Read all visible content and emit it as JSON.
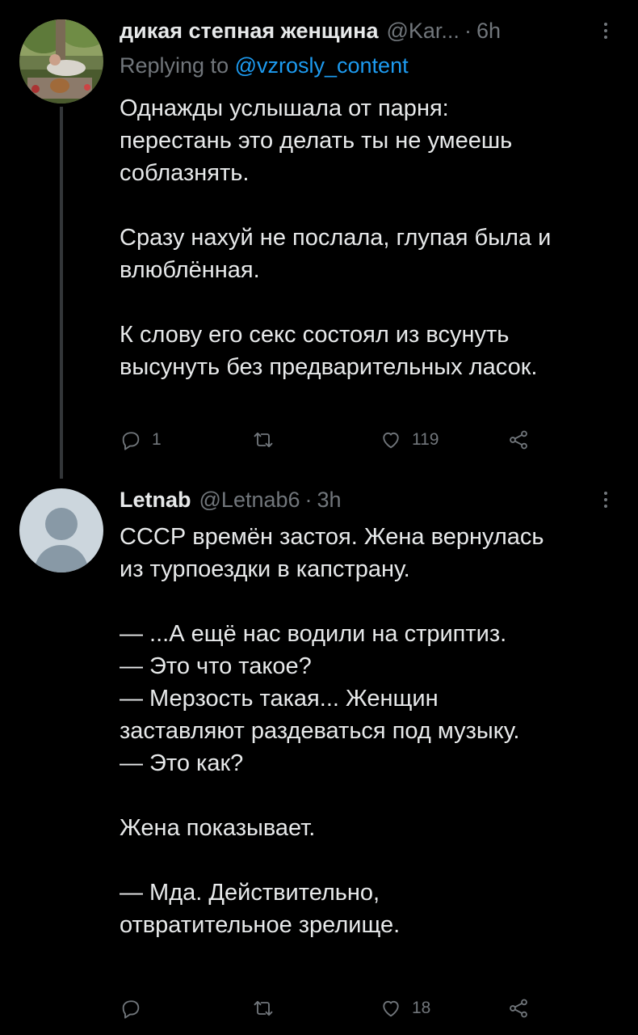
{
  "tweets": [
    {
      "name": "дикая степная женщина",
      "handle": "@Kar...",
      "separator": "·",
      "time": "6h",
      "replying_prefix": "Replying to ",
      "replying_to": "@vzrosly_content",
      "lines": [
        "Однажды услышала от парня:",
        "перестань это делать ты не умеешь",
        "соблазнять.",
        "",
        "Сразу нахуй не послала, глупая была и",
        "влюблённая.",
        "",
        "К слову его секс состоял из всунуть",
        "высунуть без предварительных ласок."
      ],
      "reply_count": "1",
      "retweet_count": "",
      "like_count": "119"
    },
    {
      "name": "Letnab",
      "handle": "@Letnab6",
      "separator": "·",
      "time": "3h",
      "lines": [
        "СССР времён застоя. Жена вернулась",
        "из турпоездки в капстрану.",
        "",
        "— ...А ещё нас водили на стриптиз.",
        "— Это что такое?",
        "— Мерзость такая... Женщин",
        "заставляют раздеваться под музыку.",
        "— Это как?",
        "",
        "Жена показывает.",
        "",
        "— Мда. Действительно,",
        "отвратительное зрелище."
      ],
      "reply_count": "",
      "retweet_count": "",
      "like_count": "18"
    }
  ],
  "icons": {
    "reply": "reply-icon",
    "retweet": "retweet-icon",
    "like": "heart-icon",
    "share": "share-icon",
    "more": "more-vertical-icon"
  },
  "colors": {
    "background": "#000000",
    "text": "#e7e9ea",
    "muted": "#71767b",
    "link": "#1d9bf0",
    "thread_line": "#333639"
  }
}
